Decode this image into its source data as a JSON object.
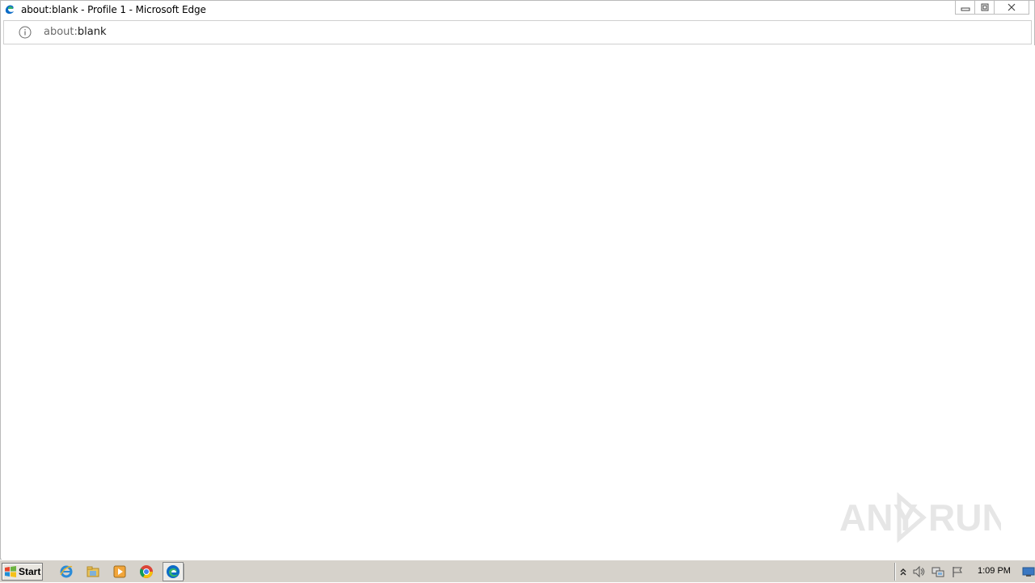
{
  "window": {
    "title": "about:blank - Profile 1 - Microsoft Edge",
    "minimize_icon": "minimize-icon",
    "maximize_icon": "restore-icon",
    "close_icon": "close-icon"
  },
  "addressbar": {
    "info_icon": "info-icon",
    "url_scheme": "about:",
    "url_rest": "blank"
  },
  "watermark": {
    "text": "ANY RUN"
  },
  "taskbar": {
    "start_label": "Start",
    "quick_launch": [
      {
        "name": "internet-explorer-icon"
      },
      {
        "name": "file-explorer-icon"
      },
      {
        "name": "media-player-icon"
      },
      {
        "name": "chrome-icon"
      },
      {
        "name": "edge-icon",
        "active": true
      }
    ],
    "tray": {
      "icons": [
        "show-hidden-icons-icon",
        "volume-icon",
        "network-icon",
        "action-center-flag-icon"
      ],
      "time": "1:09 PM"
    }
  },
  "colors": {
    "taskbar": "#d6d2cb",
    "edge_blue": "#0c6cc7",
    "edge_green": "#36b46a"
  }
}
